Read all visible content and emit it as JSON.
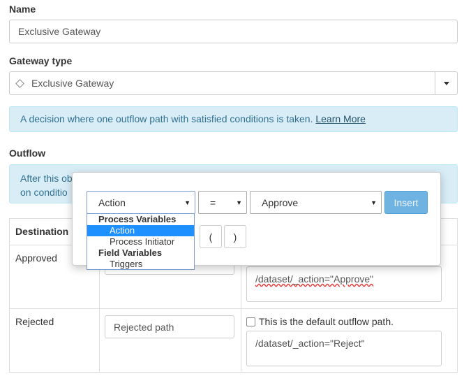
{
  "name_field": {
    "label": "Name",
    "value": "Exclusive Gateway"
  },
  "gateway_type": {
    "label": "Gateway type",
    "value": "Exclusive Gateway"
  },
  "info_alert": {
    "text": "A decision where one outflow path with satisfied conditions is taken.",
    "link": "Learn More"
  },
  "outflow": {
    "label": "Outflow",
    "alert_line1": "After this ob",
    "alert_line2": "on conditio",
    "table": {
      "header_destination": "Destination",
      "rows": [
        {
          "destination": "Approved",
          "path_value": "",
          "condition": "/dataset/_action=\"Approve\""
        },
        {
          "destination": "Rejected",
          "path_value": "Rejected path",
          "default_label": "This is the default outflow path.",
          "condition": "/dataset/_action=\"Reject\""
        }
      ]
    }
  },
  "condition_builder": {
    "variable_select": "Action",
    "operator_select": "=",
    "value_select": "Approve",
    "insert_label": "Insert",
    "open_paren": "(",
    "close_paren": ")",
    "dropdown": {
      "group1": "Process Variables",
      "option1": "Action",
      "option2": "Process Initiator",
      "group2": "Field Variables",
      "option3": "Triggers"
    }
  },
  "colors": {
    "alert_bg": "#d9edf7",
    "alert_text": "#31708f",
    "insert_bg": "#6fb3e2",
    "selected_option": "#1e90ff"
  }
}
